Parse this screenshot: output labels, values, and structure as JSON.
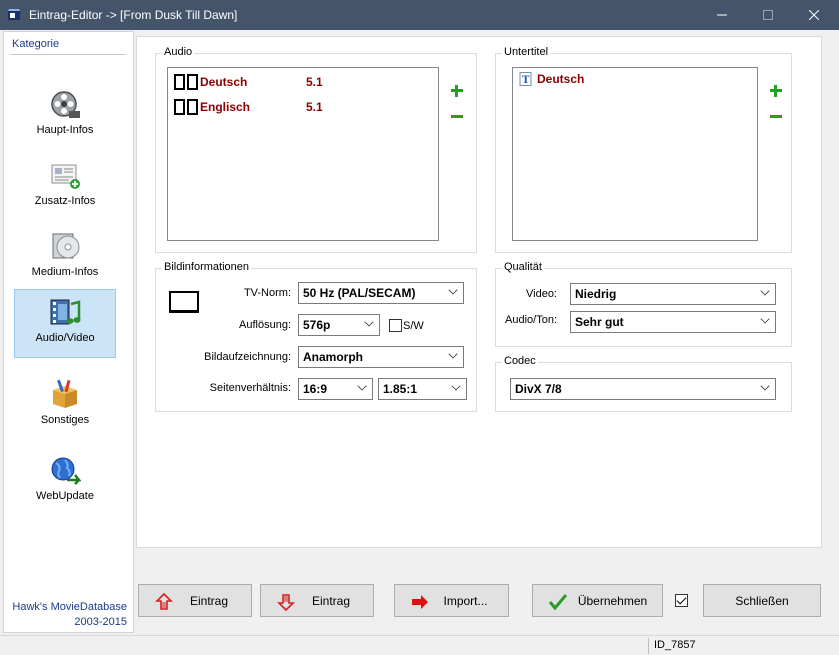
{
  "window": {
    "title": "Eintrag-Editor -> [From Dusk Till Dawn]",
    "title_bar_color": "#44546a"
  },
  "sidebar": {
    "heading": "Kategorie",
    "items": [
      {
        "label": "Haupt-Infos",
        "icon": "film-reel-icon"
      },
      {
        "label": "Zusatz-Infos",
        "icon": "info-card-icon"
      },
      {
        "label": "Medium-Infos",
        "icon": "disc-icon"
      },
      {
        "label": "Audio/Video",
        "icon": "audio-video-icon",
        "active": true
      },
      {
        "label": "Sonstiges",
        "icon": "box-icon"
      },
      {
        "label": "WebUpdate",
        "icon": "globe-icon"
      }
    ],
    "credit_line1": "Hawk's MovieDatabase",
    "credit_line2": "2003-2015"
  },
  "audio": {
    "label": "Audio",
    "tracks": [
      {
        "language": "Deutsch",
        "channels": "5.1"
      },
      {
        "language": "Englisch",
        "channels": "5.1"
      }
    ]
  },
  "subtitles": {
    "label": "Untertitel",
    "items": [
      {
        "language": "Deutsch"
      }
    ]
  },
  "picture_info": {
    "label": "Bildinformationen",
    "tv_norm_label": "TV-Norm:",
    "tv_norm_value": "50 Hz (PAL/SECAM)",
    "resolution_label": "Auflösung:",
    "resolution_value": "576p",
    "bw_label": "S/W",
    "bw_checked": false,
    "recording_label": "Bildaufzeichnung:",
    "recording_value": "Anamorph",
    "aspect_label": "Seitenverhältnis:",
    "aspect_value1": "16:9",
    "aspect_value2": "1.85:1"
  },
  "quality": {
    "label": "Qualität",
    "video_label": "Video:",
    "video_value": "Niedrig",
    "audio_label": "Audio/Ton:",
    "audio_value": "Sehr gut"
  },
  "codec": {
    "label": "Codec",
    "value": "DivX 7/8"
  },
  "buttons": {
    "entry_up": "Eintrag",
    "entry_down": "Eintrag",
    "import": "Import...",
    "apply": "Übernehmen",
    "apply_checkbox_checked": true,
    "close": "Schließen"
  },
  "status": {
    "id": "ID_7857"
  },
  "colors": {
    "accent_text": "#8b0000",
    "link_blue": "#1a3c8c",
    "add_green": "#21a121",
    "selected_bg": "#cce4f7"
  }
}
